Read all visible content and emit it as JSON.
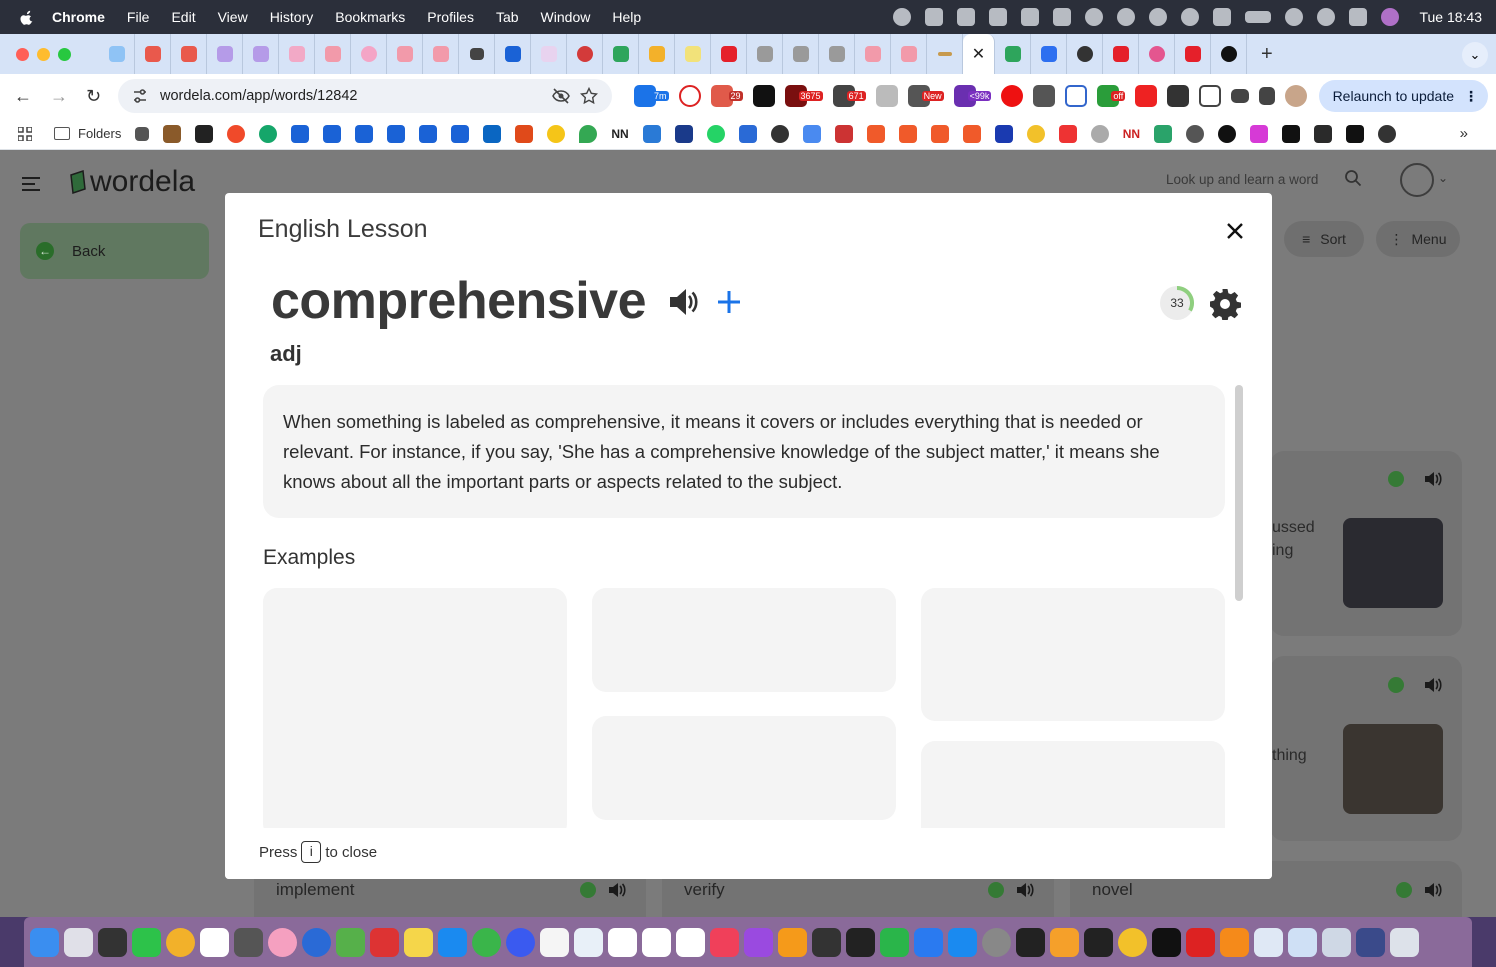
{
  "menubar": {
    "app": "Chrome",
    "items": [
      "File",
      "Edit",
      "View",
      "History",
      "Bookmarks",
      "Profiles",
      "Tab",
      "Window",
      "Help"
    ],
    "clock": "Tue 18:43"
  },
  "tabs": {
    "active_close": "✕",
    "new_tab": "+"
  },
  "toolbar": {
    "url": "wordela.com/app/words/12842",
    "relaunch": "Relaunch to update",
    "ext_badges": [
      "7m",
      "29",
      "3675",
      "671",
      "New",
      "<99k",
      "off"
    ]
  },
  "bookmarks": {
    "folder": "Folders",
    "labels": [
      "NN",
      "NN"
    ],
    "more": "»"
  },
  "app": {
    "logo": "wordela",
    "back": "Back",
    "search_placeholder": "Look up and learn a word",
    "sort": "Sort",
    "menu": "Menu",
    "card_fragments": [
      "ussed",
      "ing",
      "thing"
    ],
    "bottom_words": [
      "implement",
      "verify",
      "novel"
    ]
  },
  "modal": {
    "title": "English Lesson",
    "word": "comprehensive",
    "part_of_speech": "adj",
    "progress": "33",
    "definition": "When something is labeled as comprehensive, it means it covers or includes everything that is needed or relevant. For instance, if you say, 'She has a comprehensive knowledge of the subject matter,' it means she knows about all the important parts or aspects related to the subject.",
    "examples_heading": "Examples",
    "press_prefix": "Press",
    "press_key": "i",
    "press_suffix": "to close"
  },
  "colors": {
    "accent_plus": "#1a73e8",
    "progress_green": "#8fcf7f"
  }
}
